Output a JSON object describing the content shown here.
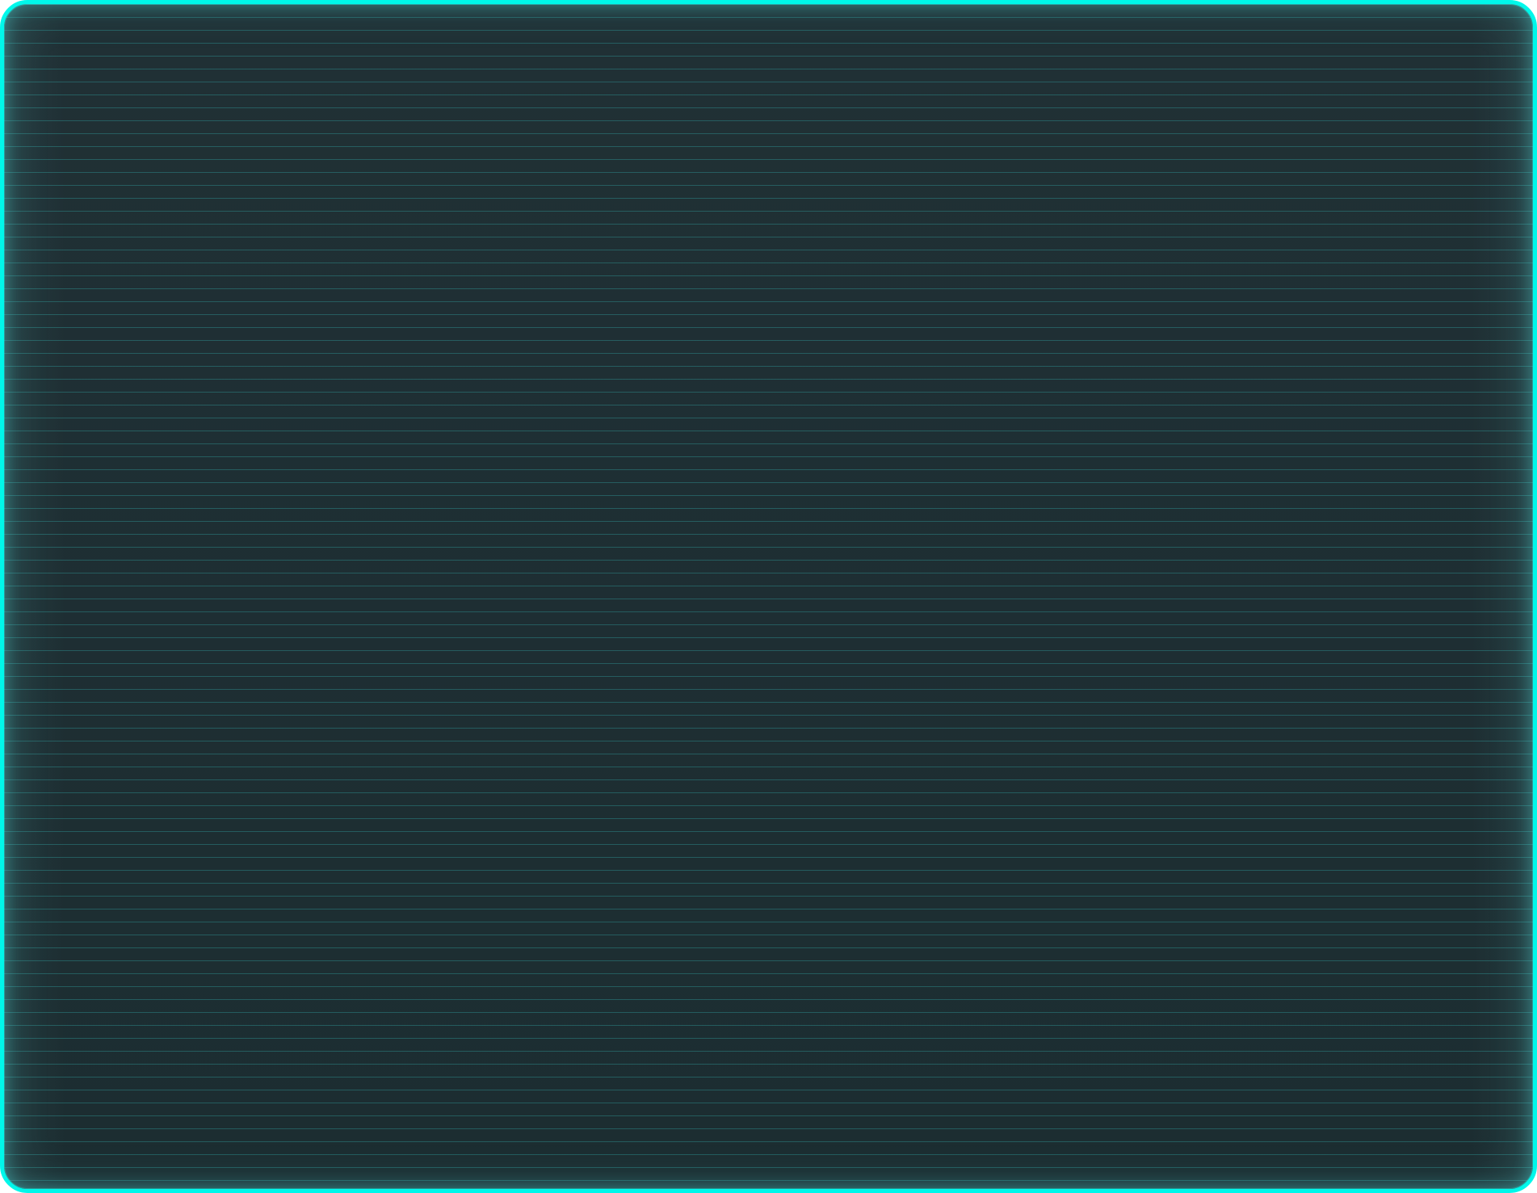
{
  "screen": {
    "accent_color": "#00f7ea",
    "background_color": "#1f3034",
    "scanline_color": "#32b2b0"
  }
}
